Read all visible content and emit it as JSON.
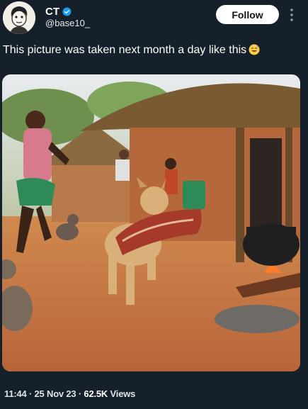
{
  "user": {
    "name": "CT",
    "handle": "@base10_",
    "follow_label": "Follow"
  },
  "tweet": {
    "text": "This picture was taken next month a day like this",
    "emoji": "sweat-smile-emoji"
  },
  "meta": {
    "time": "11:44",
    "date": "25 Nov 23",
    "views_count": "62.5K",
    "views_label": "Views",
    "separator": "·"
  },
  "icons": {
    "verified": "verified-badge-icon",
    "more": "more-options-icon"
  },
  "colors": {
    "background": "#15202b",
    "verified": "#1d9bf0",
    "follow_bg": "#ffffff"
  }
}
